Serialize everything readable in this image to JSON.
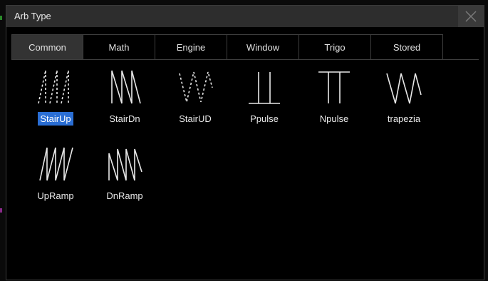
{
  "window": {
    "title": "Arb Type",
    "close_icon": "close-icon"
  },
  "tabs": [
    {
      "label": "Common",
      "active": true
    },
    {
      "label": "Math",
      "active": false
    },
    {
      "label": "Engine",
      "active": false
    },
    {
      "label": "Window",
      "active": false
    },
    {
      "label": "Trigo",
      "active": false
    },
    {
      "label": "Stored",
      "active": false
    }
  ],
  "items": [
    {
      "label": "StairUp",
      "icon": "stair-up-icon",
      "selected": true
    },
    {
      "label": "StairDn",
      "icon": "stair-down-icon",
      "selected": false
    },
    {
      "label": "StairUD",
      "icon": "stair-updown-icon",
      "selected": false
    },
    {
      "label": "Ppulse",
      "icon": "positive-pulse-icon",
      "selected": false
    },
    {
      "label": "Npulse",
      "icon": "negative-pulse-icon",
      "selected": false
    },
    {
      "label": "trapezia",
      "icon": "trapezia-icon",
      "selected": false
    },
    {
      "label": "UpRamp",
      "icon": "up-ramp-icon",
      "selected": false
    },
    {
      "label": "DnRamp",
      "icon": "down-ramp-icon",
      "selected": false
    }
  ],
  "colors": {
    "selected": "#2a6ed4",
    "active_tab": "#333333"
  }
}
